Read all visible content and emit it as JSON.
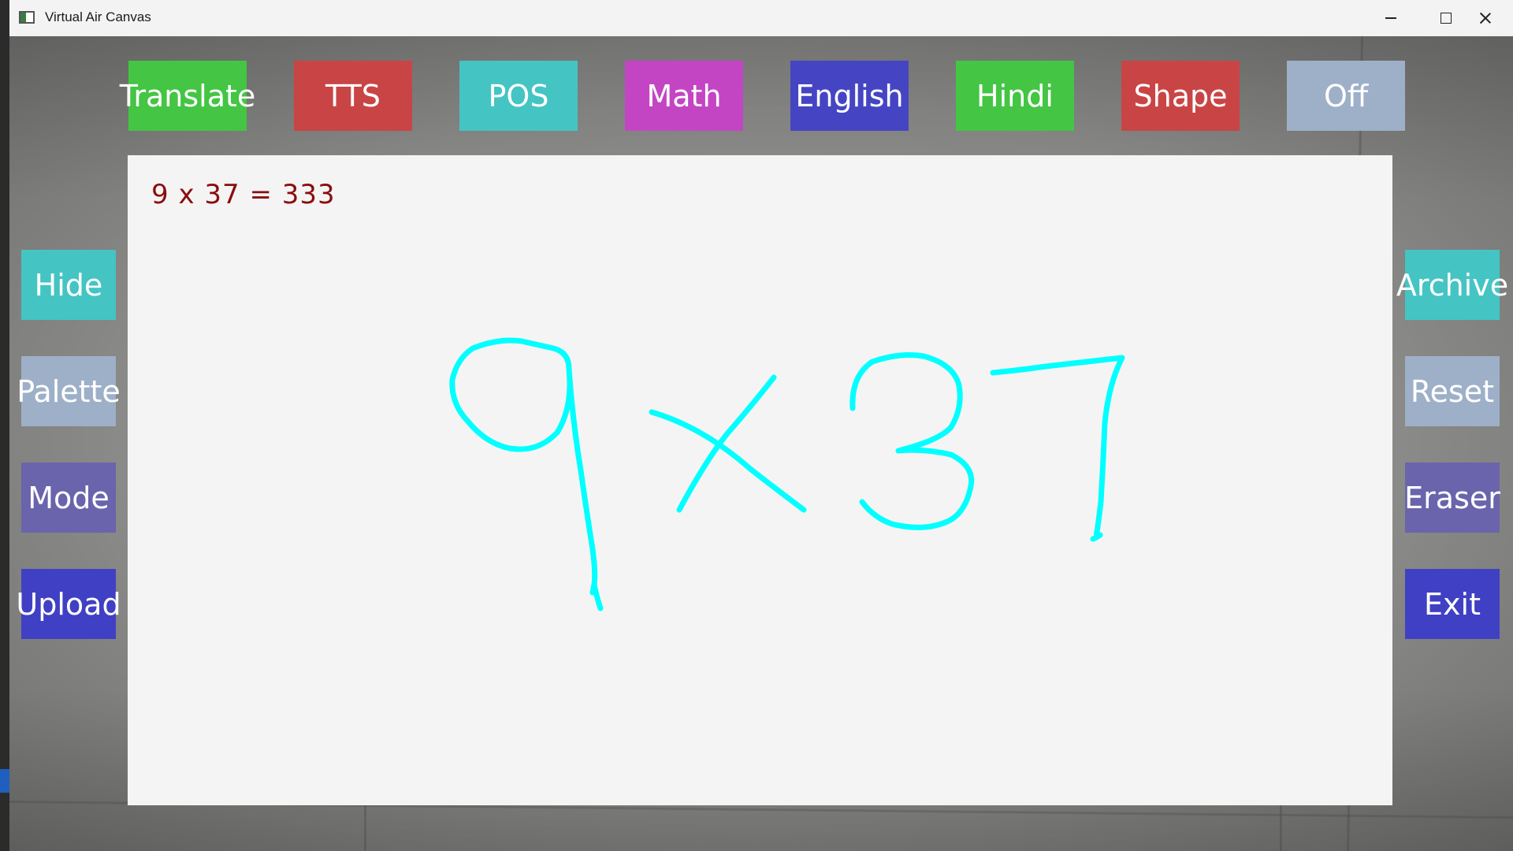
{
  "window": {
    "title": "Virtual Air Canvas"
  },
  "top_buttons": [
    {
      "label": "Translate",
      "color": "#44c544"
    },
    {
      "label": "TTS",
      "color": "#c94545"
    },
    {
      "label": "POS",
      "color": "#45c4c4"
    },
    {
      "label": "Math",
      "color": "#c445c4"
    },
    {
      "label": "English",
      "color": "#4545c4"
    },
    {
      "label": "Hindi",
      "color": "#44c544"
    },
    {
      "label": "Shape",
      "color": "#c94545"
    },
    {
      "label": "Off",
      "color": "#9eb0c8"
    }
  ],
  "left_buttons": [
    {
      "label": "Hide",
      "color": "#45c4c4"
    },
    {
      "label": "Palette",
      "color": "#9eb0c8"
    },
    {
      "label": "Mode",
      "color": "#6a64ac"
    },
    {
      "label": "Upload",
      "color": "#4040c4"
    }
  ],
  "right_buttons": [
    {
      "label": "Archive",
      "color": "#45c4c4"
    },
    {
      "label": "Reset",
      "color": "#9eb0c8"
    },
    {
      "label": "Eraser",
      "color": "#6a64ac"
    },
    {
      "label": "Exit",
      "color": "#4040c4"
    }
  ],
  "canvas": {
    "result": "9 x 37 = 333",
    "result_color": "#8b0d0d",
    "stroke_color": "#00ffff",
    "background": "#f4f4f4"
  }
}
